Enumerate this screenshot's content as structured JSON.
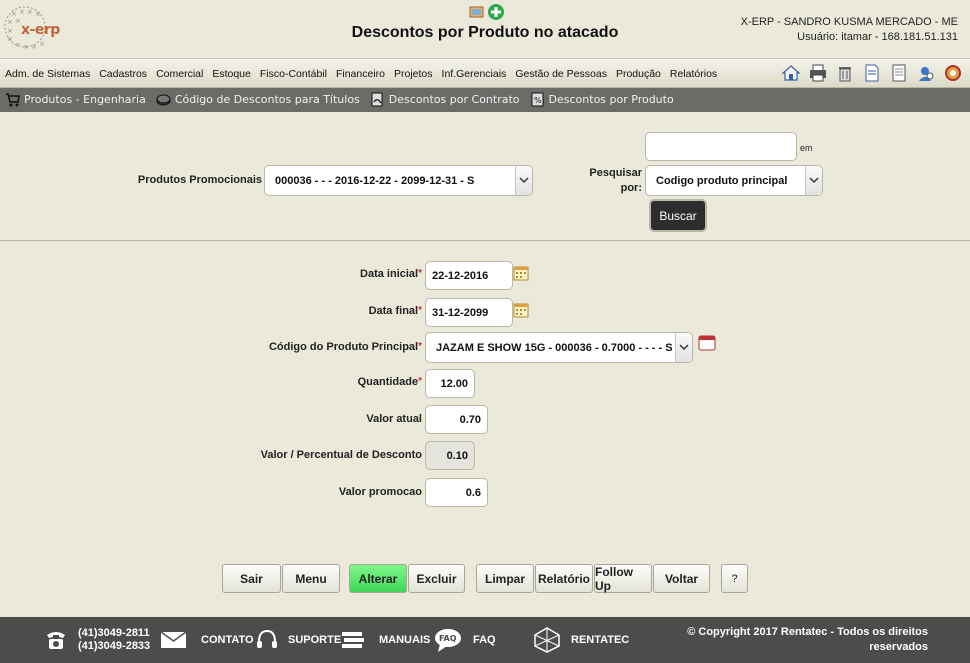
{
  "header": {
    "logo_text": "x-erp",
    "title": "Descontos por Produto no atacado",
    "company": "X-ERP - SANDRO KUSMA MERCADO - ME",
    "user_line": "Usuário: itamar - 168.181.51.131"
  },
  "main_menu": [
    "Adm. de Sistemas",
    "Cadastros",
    "Comercial",
    "Estoque",
    "Fisco-Contábil",
    "Financeiro",
    "Projetos",
    "Inf.Gerenciais",
    "Gestão de Pessoas",
    "Produção",
    "Relatórios"
  ],
  "tool_icons": [
    "home-icon",
    "printer-icon",
    "trash-icon",
    "document-icon",
    "notes-icon",
    "users-icon",
    "support-icon"
  ],
  "submenu": [
    {
      "label": "Produtos - Engenharia",
      "icon": "cart-icon"
    },
    {
      "label": "Código de Descontos para Títulos",
      "icon": "money-icon"
    },
    {
      "label": "Descontos por Contrato",
      "icon": "contract-icon"
    },
    {
      "label": "Descontos por Produto",
      "icon": "discount-doc-icon"
    }
  ],
  "search": {
    "promo_label": "Produtos Promocionais",
    "promo_value": "000036 - - - 2016-12-22 - 2099-12-31 - S",
    "search_value": "",
    "em_label": "em",
    "search_by_label_1": "Pesquisar",
    "search_by_label_2": "por:",
    "search_by_value": "Codigo produto principal",
    "search_button": "Buscar"
  },
  "form": {
    "data_inicial_label": "Data inicial",
    "data_inicial": "22-12-2016",
    "data_final_label": "Data final",
    "data_final": "31-12-2099",
    "codigo_label": "Código do Produto Principal",
    "codigo_value": "JAZAM E SHOW 15G - 000036 - 0.7000 - - - - S",
    "quantidade_label": "Quantidade",
    "quantidade": "12.00",
    "valor_atual_label": "Valor atual",
    "valor_atual": "0.70",
    "desconto_label": "Valor / Percentual de Desconto",
    "desconto": "0.10",
    "promocao_label": "Valor promocao",
    "promocao": "0.6",
    "required_mark": "*"
  },
  "actions": {
    "sair": "Sair",
    "menu": "Menu",
    "alterar": "Alterar",
    "excluir": "Excluir",
    "limpar": "Limpar",
    "relatorio": "Relatório",
    "follow_up": "Follow Up",
    "voltar": "Voltar",
    "help": "?"
  },
  "footer": {
    "phone_1": "(41)3049-2811",
    "phone_2": "(41)3049-2833",
    "contato": "CONTATO",
    "suporte": "SUPORTE",
    "manuais": "MANUAIS",
    "faq": "FAQ",
    "faq_icon_text": "FAQ",
    "rentatec": "RENTATEC",
    "copyright_1": "© Copyright 2017 Rentatec - Todos os direitos",
    "copyright_2": "reservados"
  },
  "colors": {
    "background": "#eae9da",
    "submenu": "#6b6b68",
    "footer": "#4c4c4a",
    "accent_green": "#3ed65a"
  }
}
